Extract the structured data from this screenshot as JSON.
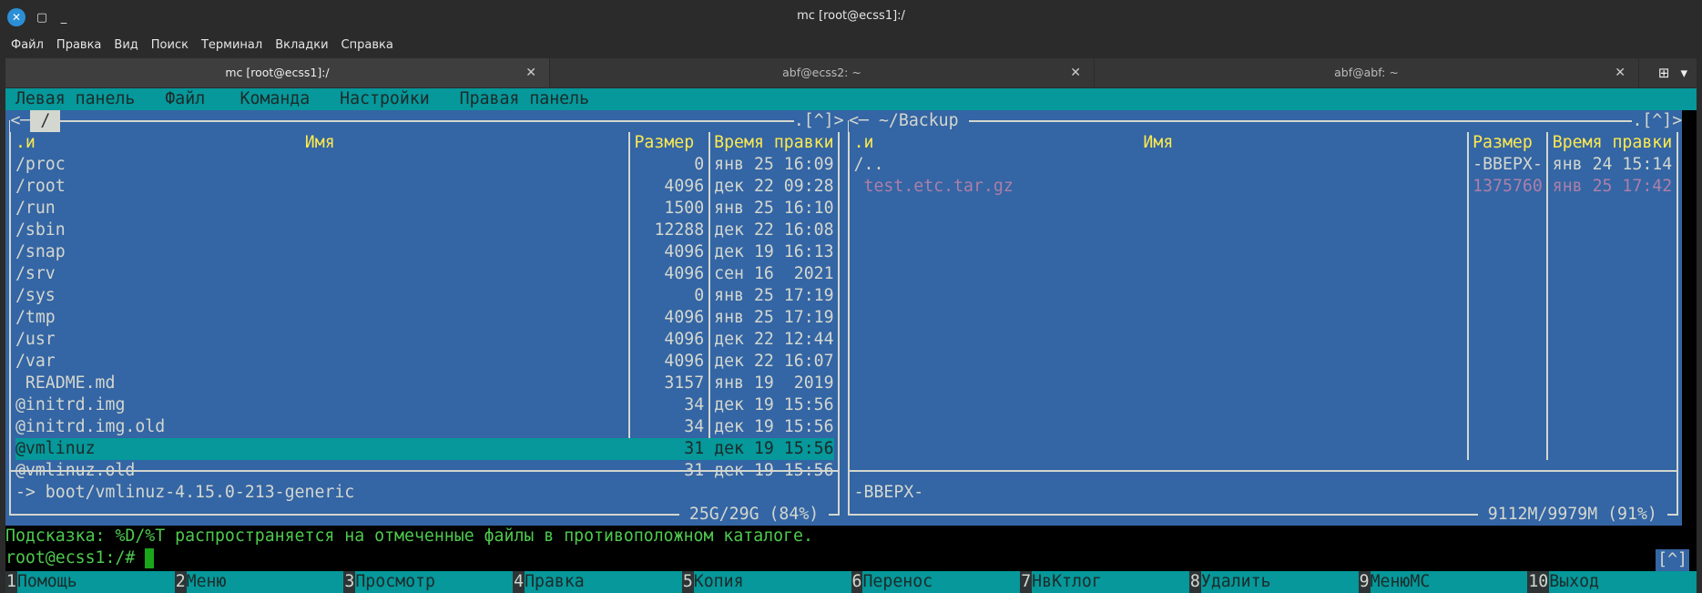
{
  "window": {
    "title": "mc [root@ecss1]:/"
  },
  "menubar": [
    "Файл",
    "Правка",
    "Вид",
    "Поиск",
    "Терминал",
    "Вкладки",
    "Справка"
  ],
  "tabs": [
    {
      "label": "mc [root@ecss1]:/",
      "active": true
    },
    {
      "label": "abf@ecss2: ~",
      "active": false
    },
    {
      "label": "abf@abf: ~",
      "active": false
    }
  ],
  "mc_menu": [
    "Левая панель",
    "Файл",
    "Команда",
    "Настройки",
    "Правая панель"
  ],
  "left": {
    "path": "/",
    "corner": ".[^]>",
    "headers": {
      "name_prefix": ".и",
      "name": "Имя",
      "size": "Размер",
      "time": "Время правки"
    },
    "files": [
      {
        "name": "/proc",
        "size": "0",
        "time": "янв 25 16:09"
      },
      {
        "name": "/root",
        "size": "4096",
        "time": "дек 22 09:28"
      },
      {
        "name": "/run",
        "size": "1500",
        "time": "янв 25 16:10"
      },
      {
        "name": "/sbin",
        "size": "12288",
        "time": "дек 22 16:08"
      },
      {
        "name": "/snap",
        "size": "4096",
        "time": "дек 19 16:13"
      },
      {
        "name": "/srv",
        "size": "4096",
        "time": "сен 16  2021"
      },
      {
        "name": "/sys",
        "size": "0",
        "time": "янв 25 17:19"
      },
      {
        "name": "/tmp",
        "size": "4096",
        "time": "янв 25 17:19"
      },
      {
        "name": "/usr",
        "size": "4096",
        "time": "дек 22 12:44"
      },
      {
        "name": "/var",
        "size": "4096",
        "time": "дек 22 16:07"
      },
      {
        "name": " README.md",
        "size": "3157",
        "time": "янв 19  2019"
      },
      {
        "name": "@initrd.img",
        "size": "34",
        "time": "дек 19 15:56"
      },
      {
        "name": "@initrd.img.old",
        "size": "34",
        "time": "дек 19 15:56"
      },
      {
        "name": "@vmlinuz",
        "size": "31",
        "time": "дек 19 15:56",
        "selected": true
      },
      {
        "name": "@vmlinuz.old",
        "size": "31",
        "time": "дек 19 15:56"
      }
    ],
    "info": "-> boot/vmlinuz-4.15.0-213-generic",
    "disk": "25G/29G (84%)"
  },
  "right": {
    "path": "~/Backup",
    "corner": ".[^]>",
    "headers": {
      "name_prefix": ".и",
      "name": "Имя",
      "size": "Размер",
      "time": "Время правки"
    },
    "files": [
      {
        "name": "/..",
        "size": "-ВВЕРХ-",
        "time": "янв 24 15:14"
      },
      {
        "name": " test.etc.tar.gz",
        "size": "1375760",
        "time": "янв 25 17:42",
        "color": "#ad7fa8"
      }
    ],
    "info": "-ВВЕРХ-",
    "disk": "9112M/9979M (91%)"
  },
  "hint": "Подсказка: %D/%T распространяется на отмеченные файлы в противоположном каталоге.",
  "prompt": "root@ecss1:/# ",
  "up_button": "[^]",
  "fkeys": [
    {
      "n": "1",
      "l": "Помощь"
    },
    {
      "n": "2",
      "l": "Меню"
    },
    {
      "n": "3",
      "l": "Просмотр"
    },
    {
      "n": "4",
      "l": "Правка"
    },
    {
      "n": "5",
      "l": "Копия"
    },
    {
      "n": "6",
      "l": "Перенос"
    },
    {
      "n": "7",
      "l": "НвКтлог"
    },
    {
      "n": "8",
      "l": "Удалить"
    },
    {
      "n": "9",
      "l": "МенюMC"
    },
    {
      "n": "10",
      "l": "Выход"
    }
  ]
}
